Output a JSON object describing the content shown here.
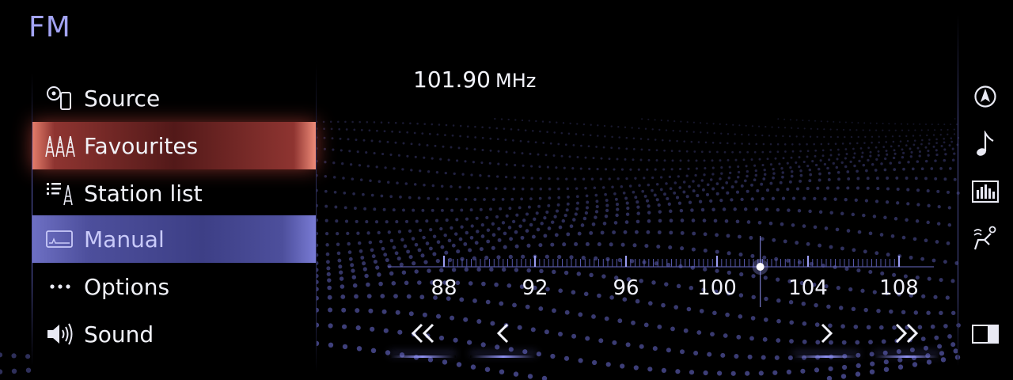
{
  "header": {
    "title": "FM"
  },
  "menu": {
    "items": [
      {
        "label": "Source",
        "icon": "source-disc-phone-icon",
        "state": "normal"
      },
      {
        "label": "Favourites",
        "icon": "radio-towers-icon",
        "state": "highlighted"
      },
      {
        "label": "Station list",
        "icon": "list-tower-icon",
        "state": "normal"
      },
      {
        "label": "Manual",
        "icon": "manual-tuner-icon",
        "state": "selected"
      },
      {
        "label": "Options",
        "icon": "more-dots-icon",
        "state": "normal"
      },
      {
        "label": "Sound",
        "icon": "speaker-icon",
        "state": "normal"
      }
    ]
  },
  "tuner": {
    "frequency": "101.90",
    "unit": "MHz",
    "current_value": 101.9,
    "range": [
      86,
      110
    ],
    "tick_labels": [
      "88",
      "92",
      "96",
      "100",
      "104",
      "108"
    ]
  },
  "seek": {
    "buttons": [
      {
        "icon": "fast-seek-back-icon"
      },
      {
        "icon": "seek-back-icon"
      },
      {
        "icon": "seek-forward-icon"
      },
      {
        "icon": "fast-seek-forward-icon"
      }
    ]
  },
  "rail": {
    "buttons": [
      "navigation-icon",
      "music-note-icon",
      "equalizer-icon",
      "seat-climate-icon",
      "split-screen-icon"
    ]
  },
  "colors": {
    "accent": "#a3a4f4",
    "favourite_highlight": "#c8504a",
    "selected": "#4d4f9c",
    "wave": "#6668c8"
  }
}
